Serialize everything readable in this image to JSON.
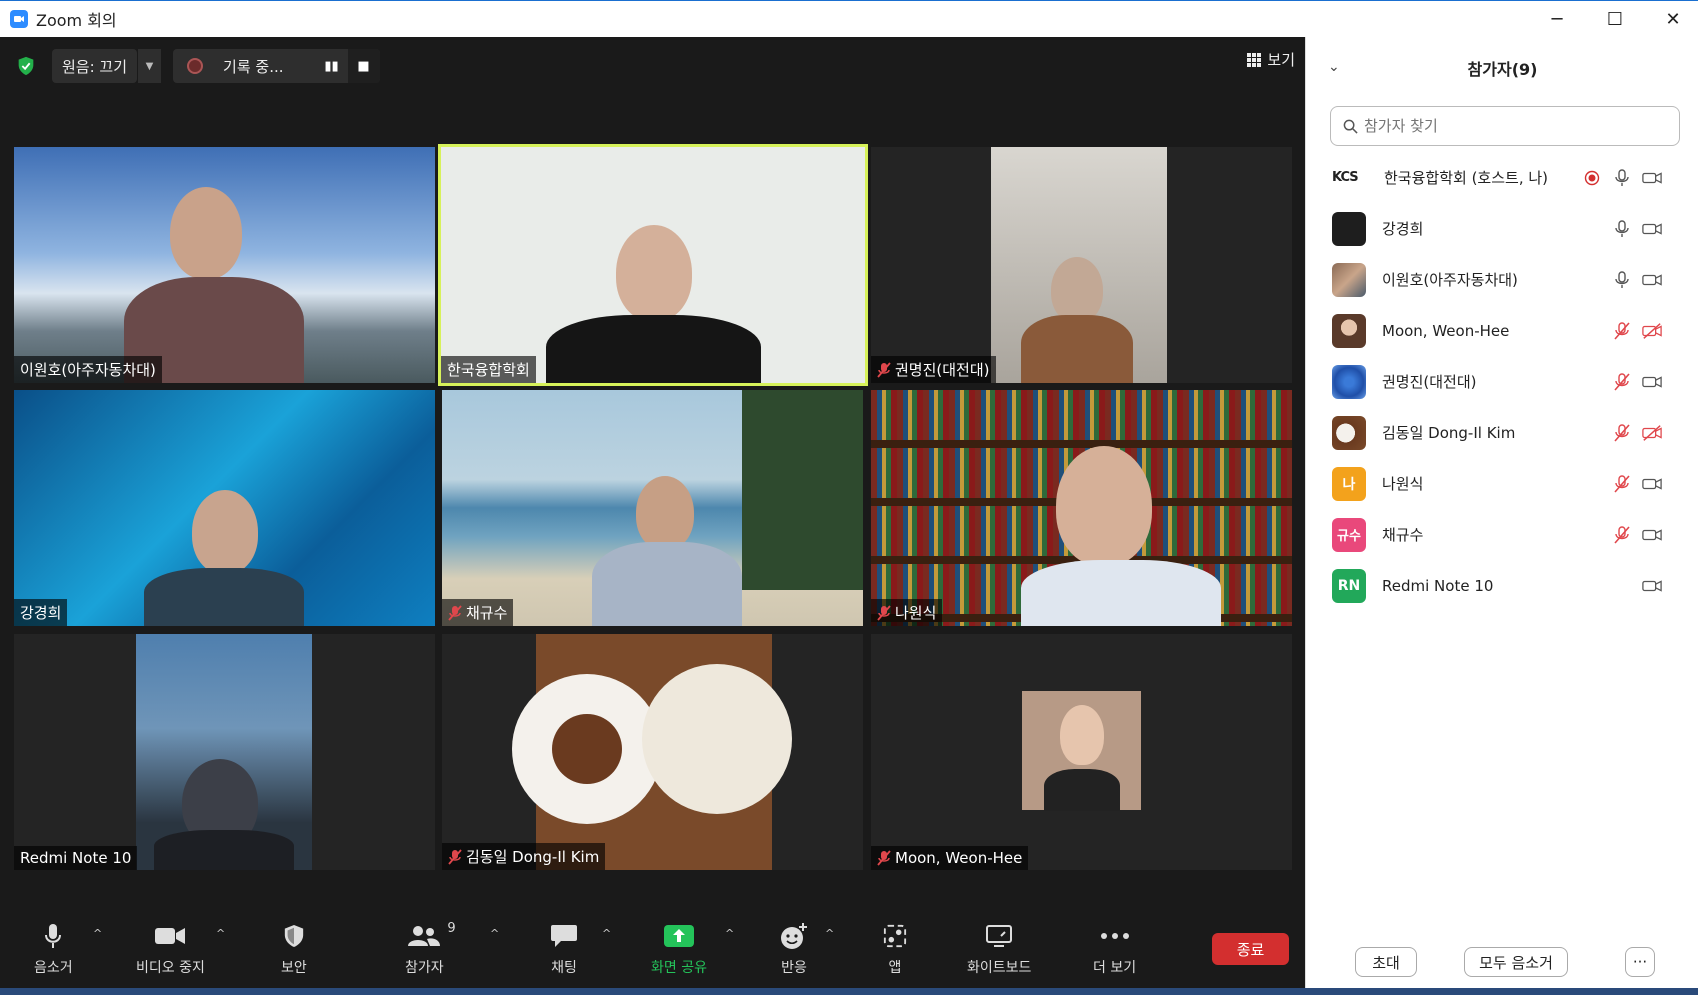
{
  "window": {
    "title": "Zoom 회의",
    "controls": {
      "minimize": "─",
      "maximize": "☐",
      "close": "✕"
    }
  },
  "topbar": {
    "original_sound": "원음: 끄기",
    "recording": "기록 중...",
    "view": "보기"
  },
  "tiles": [
    {
      "name": "이원호(아주자동차대)",
      "muted": false,
      "active": false
    },
    {
      "name": "한국융합학회",
      "muted": false,
      "active": true
    },
    {
      "name": "권명진(대전대)",
      "muted": true,
      "active": false
    },
    {
      "name": "강경희",
      "muted": false,
      "active": false
    },
    {
      "name": "채규수",
      "muted": true,
      "active": false
    },
    {
      "name": "나원식",
      "muted": true,
      "active": false
    },
    {
      "name": "Redmi Note 10",
      "muted": false,
      "active": false
    },
    {
      "name": "김동일 Dong-Il Kim",
      "muted": true,
      "active": false
    },
    {
      "name": "Moon, Weon-Hee",
      "muted": true,
      "active": false
    }
  ],
  "toolbar": {
    "mute": "음소거",
    "stop_video": "비디오 중지",
    "security": "보안",
    "participants": "참가자",
    "participants_count": "9",
    "chat": "채팅",
    "share_screen": "화면 공유",
    "reactions": "반응",
    "apps": "앱",
    "whiteboard": "화이트보드",
    "more": "더 보기",
    "end": "종료"
  },
  "panel": {
    "title": "참가자(9)",
    "search_placeholder": "참가자 찾기",
    "participants": [
      {
        "name": "한국융합학회 (호스트, 나)",
        "avatar": "KCS",
        "recording": true,
        "mic": "on",
        "video": "on"
      },
      {
        "name": "강경희",
        "avatar": "",
        "mic": "on",
        "video": "on"
      },
      {
        "name": "이원호(아주자동차대)",
        "avatar": "",
        "mic": "on",
        "video": "on"
      },
      {
        "name": "Moon, Weon-Hee",
        "avatar": "",
        "mic": "off",
        "video": "off"
      },
      {
        "name": "권명진(대전대)",
        "avatar": "",
        "mic": "off",
        "video": "on"
      },
      {
        "name": "김동일 Dong-Il Kim",
        "avatar": "",
        "mic": "off",
        "video": "off"
      },
      {
        "name": "나원식",
        "avatar": "나",
        "mic": "off",
        "video": "on"
      },
      {
        "name": "채규수",
        "avatar": "규수",
        "mic": "off",
        "video": "on"
      },
      {
        "name": "Redmi Note 10",
        "avatar": "RN",
        "mic": "none",
        "video": "on"
      }
    ],
    "invite": "초대",
    "mute_all": "모두 음소거",
    "more": "···"
  },
  "colors": {
    "accent": "#2d8cff",
    "end": "#d32f2f",
    "muted": "#e0474c",
    "share": "#24c35a",
    "active_border": "#d7f25a"
  }
}
